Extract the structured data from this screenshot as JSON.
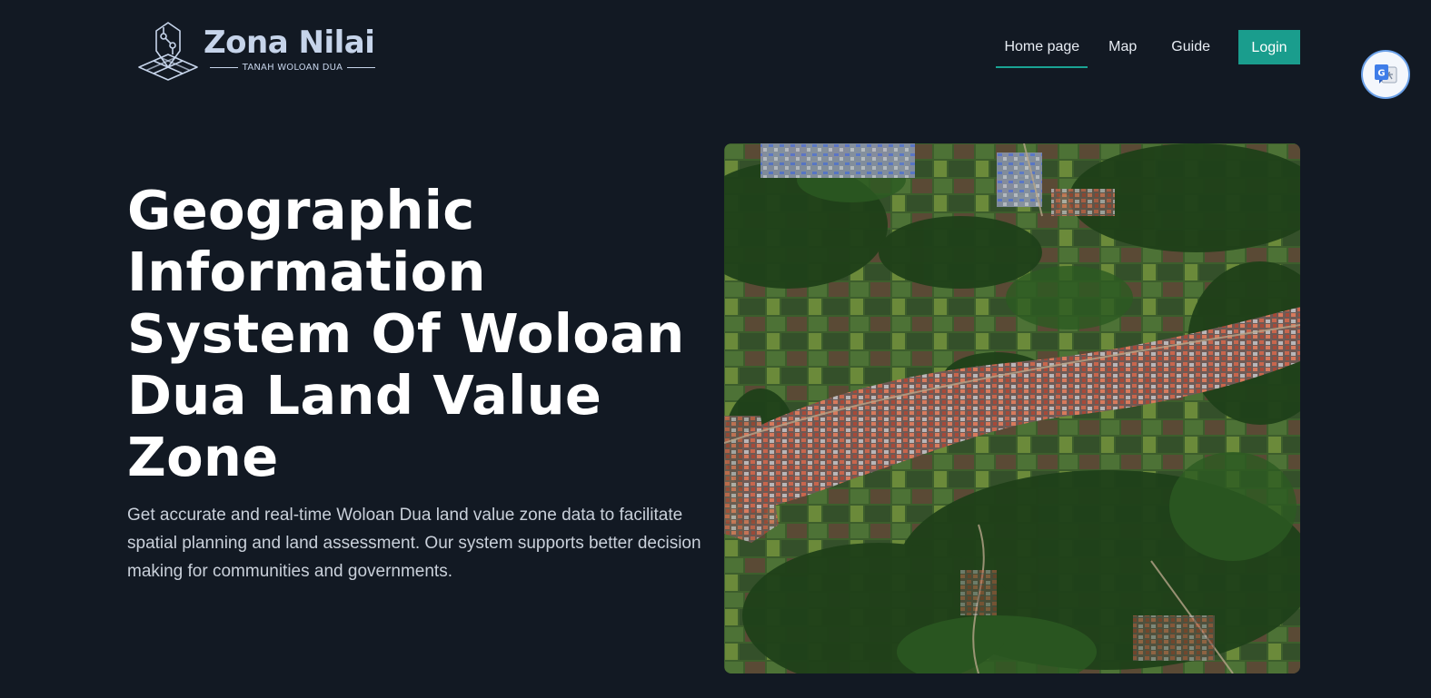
{
  "brand": {
    "name": "Zona Nilai",
    "tagline": "TANAH WOLOAN DUA",
    "logo_icon": "map-pin-grid-logo"
  },
  "nav": {
    "items": [
      {
        "label": "Home page",
        "active": true
      },
      {
        "label": "Map",
        "active": false
      },
      {
        "label": "Guide",
        "active": false
      }
    ],
    "login_label": "Login"
  },
  "translate": {
    "icon": "google-translate-icon"
  },
  "hero": {
    "title": "Geographic Information System Of Woloan Dua Land Value Zone",
    "description": "Get accurate and real-time Woloan Dua land value zone data to facilitate spatial planning and land assessment. Our system supports better decision making for communities and governments.",
    "image_icon": "satellite-aerial-image"
  },
  "colors": {
    "background": "#121923",
    "accent": "#1a9d8d",
    "brand_text": "#c6d4ea",
    "body_text": "#c9d0da"
  }
}
